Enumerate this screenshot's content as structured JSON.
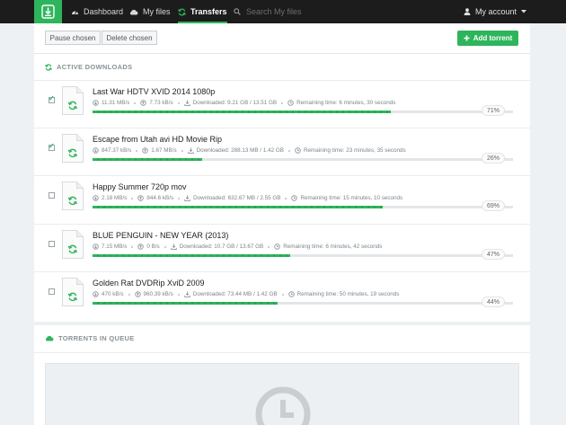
{
  "nav": {
    "dashboard": "Dashboard",
    "my_files": "My files",
    "transfers": "Transfers",
    "search_placeholder": "Search My files",
    "account": "My account"
  },
  "toolbar": {
    "pause": "Pause chosen",
    "delete": "Delete chosen",
    "add": "Add torrent"
  },
  "active": {
    "heading": "ACTIVE DOWNLOADS",
    "rows": [
      {
        "title": "Last War HDTV XVID 2014 1080p",
        "down": "11.31 MB/s",
        "up": "7.73 kB/s",
        "downloaded": "Downloaded: 9.21 GB / 13.51 GB",
        "remaining": "Remaining time: 6 minutes, 30 seconds",
        "percent": "71%",
        "progress": 0.71,
        "checked": true
      },
      {
        "title": "Escape from Utah avi HD Movie Rip",
        "down": "847.37 kB/s",
        "up": "1.67 MB/s",
        "downloaded": "Downloaded: 288.13 MB / 1.42 GB",
        "remaining": "Remaining time: 23 minutes, 35 seconds",
        "percent": "26%",
        "progress": 0.26,
        "checked": true
      },
      {
        "title": "Happy Summer 720p mov",
        "down": "2.18 MB/s",
        "up": "844.6 kB/s",
        "downloaded": "Downloaded: 632.67 MB / 2.55 GB",
        "remaining": "Remaining time: 15 minutes, 10 seconds",
        "percent": "69%",
        "progress": 0.69,
        "checked": false
      },
      {
        "title": "BLUE PENGUIN - NEW YEAR (2013)",
        "down": "7.15 MB/s",
        "up": "0 B/s",
        "downloaded": "Downloaded: 10.7 GB / 13.67 GB",
        "remaining": "Remaining time: 6 minutes, 42 seconds",
        "percent": "47%",
        "progress": 0.47,
        "checked": false
      },
      {
        "title": "Golden Rat DVDRip XviD 2009",
        "down": "470 kB/s",
        "up": "960.39 kB/s",
        "downloaded": "Downloaded: 73.44 MB / 1.42 GB",
        "remaining": "Remaining time: 50 minutes, 19 seconds",
        "percent": "44%",
        "progress": 0.44,
        "checked": false
      }
    ]
  },
  "queue": {
    "heading": "TORRENTS IN QUEUE"
  },
  "colors": {
    "accent": "#2eb55c",
    "topbar": "#1c1c1c",
    "background": "#eef1f3"
  }
}
